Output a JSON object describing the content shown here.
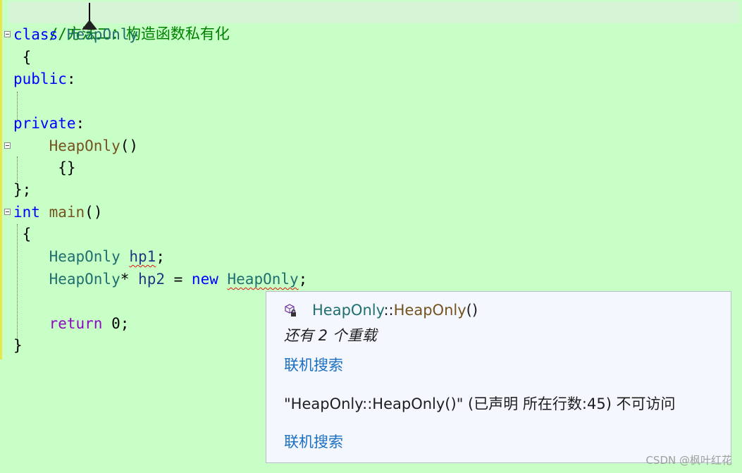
{
  "editor": {
    "lines": [
      {
        "comment": "//方法二：构造函数私有化"
      },
      {
        "kw": "class",
        "name": "HeapOnly"
      },
      {
        "text": " {"
      },
      {
        "kw": "public",
        "tail": ":"
      },
      {
        "text": ""
      },
      {
        "kw": "private",
        "tail": ":"
      },
      {
        "fn": "HeapOnly",
        "tail": "()"
      },
      {
        "text": "{}"
      },
      {
        "text": "};"
      },
      {
        "kw": "int",
        "fn": "main",
        "tail": "()"
      },
      {
        "text": " {"
      },
      {
        "type": "HeapOnly",
        "var": "hp1",
        "tail": ";"
      },
      {
        "type": "HeapOnly",
        "op": "*",
        "var": "hp2",
        "eq": " = ",
        "kw": "new",
        "type2": "HeapOnly",
        "tail": ";"
      },
      {
        "text": ""
      },
      {
        "kw": "return",
        "tail": " 0;"
      },
      {
        "text": "}"
      }
    ]
  },
  "tooltip": {
    "class_name": "HeapOnly",
    "separator": "::",
    "func_name": "HeapOnly",
    "parens": "()",
    "overloads": "还有 2 个重载",
    "link1": "联机搜索",
    "error": "\"HeapOnly::HeapOnly()\" (已声明 所在行数:45) 不可访问",
    "link2": "联机搜索"
  },
  "watermark": "CSDN @枫叶红花",
  "colors": {
    "background": "#c7ffc7",
    "keyword": "#0000ff",
    "type": "#1f6f6f",
    "function": "#74531f",
    "link": "#1a6fc2"
  }
}
